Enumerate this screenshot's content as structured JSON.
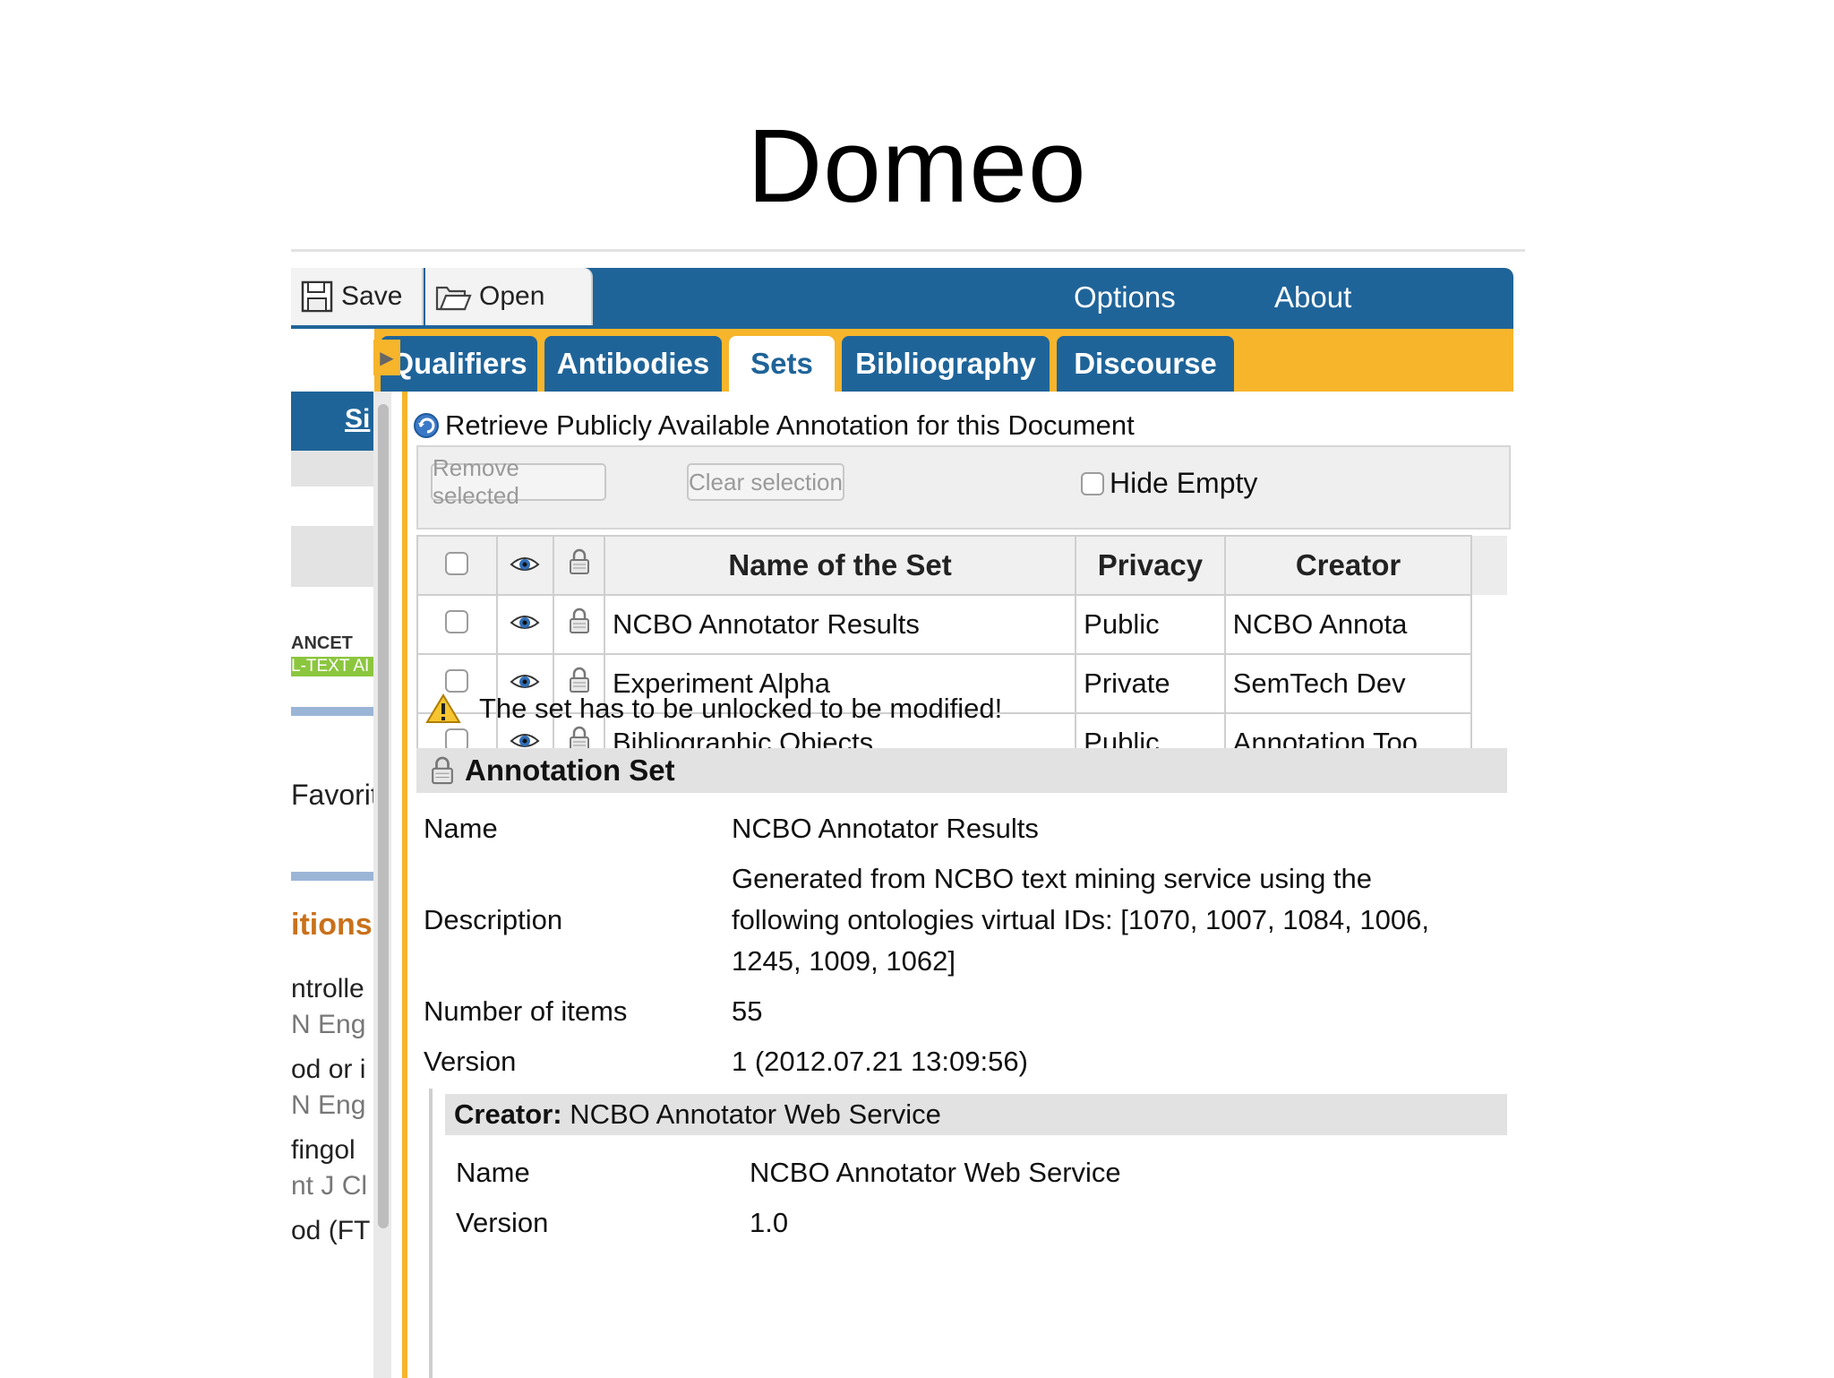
{
  "slide_title": "Domeo",
  "toolbar": {
    "save_label": "Save",
    "open_label": "Open",
    "options_label": "Options",
    "about_label": "About"
  },
  "tabs": [
    {
      "label": "Qualifiers",
      "active": false
    },
    {
      "label": "Antibodies",
      "active": false
    },
    {
      "label": "Sets",
      "active": true
    },
    {
      "label": "Bibliography",
      "active": false
    },
    {
      "label": "Discourse",
      "active": false
    }
  ],
  "sidebar_fragments": [
    "Si",
    "ANCET",
    "L-TEXT AI",
    "Favorit",
    "itions",
    "ntrolle",
    "N Eng",
    "od or i",
    "N Eng",
    "fingol",
    "nt J Cl",
    "od (FT"
  ],
  "retrieve_link": "Retrieve Publicly Available Annotation for this Document",
  "actions": {
    "remove_selected": "Remove selected",
    "clear_selection": "Clear selection",
    "hide_empty": "Hide Empty"
  },
  "table": {
    "headers": {
      "name": "Name of the Set",
      "privacy": "Privacy",
      "creator": "Creator"
    },
    "rows": [
      {
        "name": "NCBO Annotator Results",
        "privacy": "Public",
        "creator": "NCBO Annota"
      },
      {
        "name": "Experiment Alpha",
        "privacy": "Private",
        "creator": "SemTech Dev"
      },
      {
        "name": "Bibliographic Objects",
        "privacy": "Public",
        "creator": "Annotation Too"
      }
    ]
  },
  "warning": "The set has to be unlocked to be modified!",
  "annotation_set": {
    "title": "Annotation Set",
    "name_label": "Name",
    "name_value": "NCBO Annotator Results",
    "description_label": "Description",
    "description_lines": [
      "Generated from NCBO text mining service using the",
      "following ontologies virtual IDs: [1070, 1007, 1084, 1006,",
      "1245, 1009, 1062]"
    ],
    "items_label": "Number of items",
    "items_value": "55",
    "version_label": "Version",
    "version_value": "1 (2012.07.21 13:09:56)"
  },
  "creator": {
    "head_label": "Creator:",
    "head_value": "NCBO Annotator Web Service",
    "name_label": "Name",
    "name_value": "NCBO Annotator Web Service",
    "version_label": "Version",
    "version_value": "1.0"
  },
  "colors": {
    "brand_blue": "#1f6499",
    "accent_orange": "#f7b52c"
  }
}
